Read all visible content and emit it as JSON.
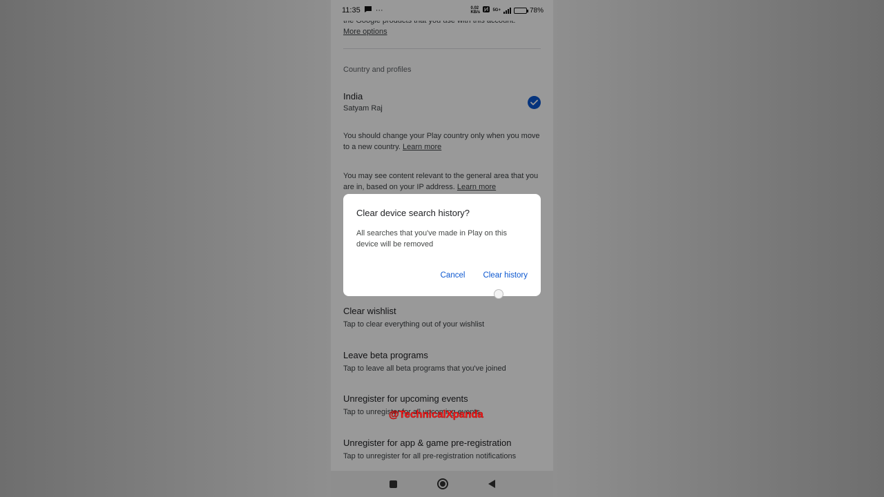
{
  "status_bar": {
    "time": "11:35",
    "more": "···",
    "speed": "0.02 KB/s",
    "network": "5G+",
    "battery": "78%"
  },
  "account": {
    "intro_text": "the Google products that you use with this account.",
    "more_options": "More options"
  },
  "country": {
    "section_label": "Country and profiles",
    "name": "India",
    "profile": "Satyam Raj",
    "change_text": "You should change your Play country only when you move to a new country.",
    "change_link": "Learn more",
    "ip_text": "You may see content relevant to the general area that you are in, based on your IP address.",
    "ip_link": "Learn more"
  },
  "settings": [
    {
      "title": "Clear wishlist",
      "subtitle": "Tap to clear everything out of your wishlist"
    },
    {
      "title": "Leave beta programs",
      "subtitle": "Tap to leave all beta programs that you've joined"
    },
    {
      "title": "Unregister for upcoming events",
      "subtitle": "Tap to unregister for all upcoming events"
    },
    {
      "title": "Unregister for app & game pre-registration",
      "subtitle": "Tap to unregister for all pre-registration notifications"
    }
  ],
  "dialog": {
    "title": "Clear device search history?",
    "body": "All searches that you've made in Play on this device will be removed",
    "cancel_label": "Cancel",
    "confirm_label": "Clear history"
  },
  "watermark": "@TechnicalXpanda",
  "colors": {
    "accent": "#0b57d0",
    "watermark": "#ff1a1a"
  }
}
